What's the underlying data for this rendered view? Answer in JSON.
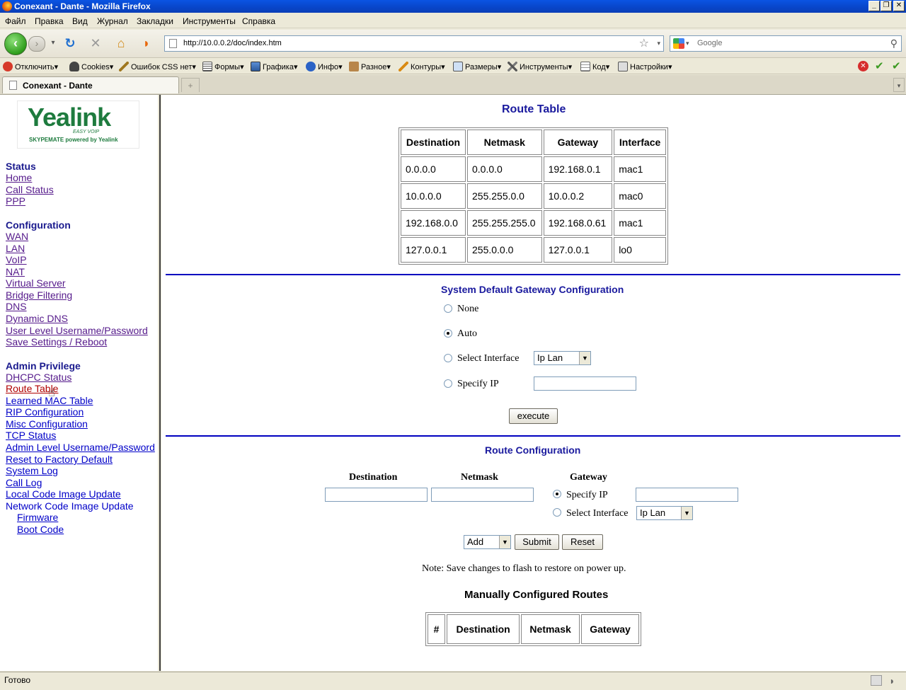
{
  "window": {
    "title": "Conexant - Dante - Mozilla Firefox"
  },
  "menubar": [
    "Файл",
    "Правка",
    "Вид",
    "Журнал",
    "Закладки",
    "Инструменты",
    "Справка"
  ],
  "navbar": {
    "url": "http://10.0.0.2/doc/index.htm",
    "search_placeholder": "Google"
  },
  "devbar": {
    "items": [
      "Отключить",
      "Cookies",
      "Ошибок CSS нет",
      "Формы",
      "Графика",
      "Инфо",
      "Разное",
      "Контуры",
      "Размеры",
      "Инструменты",
      "Код",
      "Настройки"
    ]
  },
  "tabs": [
    {
      "label": "Conexant - Dante"
    }
  ],
  "sidebar": {
    "sections": [
      {
        "heading": "Status",
        "links": [
          "Home",
          "Call Status",
          "PPP"
        ]
      },
      {
        "heading": "Configuration",
        "links": [
          "WAN",
          "LAN",
          "VoIP",
          "NAT",
          "Virtual Server",
          "Bridge Filtering",
          "DNS",
          "Dynamic DNS",
          "User Level Username/Password",
          "Save Settings / Reboot"
        ]
      },
      {
        "heading": "Admin Privilege",
        "links": [
          "DHCPC Status",
          "Route Table",
          "Learned MAC Table",
          "RIP Configuration",
          "Misc Configuration",
          "TCP Status",
          "Admin Level Username/Password",
          "Reset to Factory Default",
          "System Log",
          "Call Log",
          "Local Code Image Update",
          "Network Code Image Update",
          "Firmware",
          "Boot Code"
        ]
      }
    ]
  },
  "route_table": {
    "title": "Route Table",
    "headers": [
      "Destination",
      "Netmask",
      "Gateway",
      "Interface"
    ],
    "rows": [
      [
        "0.0.0.0",
        "0.0.0.0",
        "192.168.0.1",
        "mac1"
      ],
      [
        "10.0.0.0",
        "255.255.0.0",
        "10.0.0.2",
        "mac0"
      ],
      [
        "192.168.0.0",
        "255.255.255.0",
        "192.168.0.61",
        "mac1"
      ],
      [
        "127.0.0.1",
        "255.0.0.0",
        "127.0.0.1",
        "lo0"
      ]
    ]
  },
  "gateway_config": {
    "title": "System Default Gateway Configuration",
    "options": [
      "None",
      "Auto",
      "Select Interface",
      "Specify IP"
    ],
    "selected": "Auto",
    "interface_value": "Ip Lan",
    "execute_label": "execute"
  },
  "route_config": {
    "title": "Route Configuration",
    "col_destination": "Destination",
    "col_netmask": "Netmask",
    "col_gateway": "Gateway",
    "specify_ip_label": "Specify IP",
    "select_interface_label": "Select Interface",
    "interface_value": "Ip Lan",
    "action_value": "Add",
    "submit_label": "Submit",
    "reset_label": "Reset",
    "note": "Note: Save changes to flash to restore on power up."
  },
  "manual_routes": {
    "title": "Manually Configured Routes",
    "headers": [
      "#",
      "Destination",
      "Netmask",
      "Gateway"
    ]
  },
  "statusbar": {
    "text": "Готово"
  }
}
